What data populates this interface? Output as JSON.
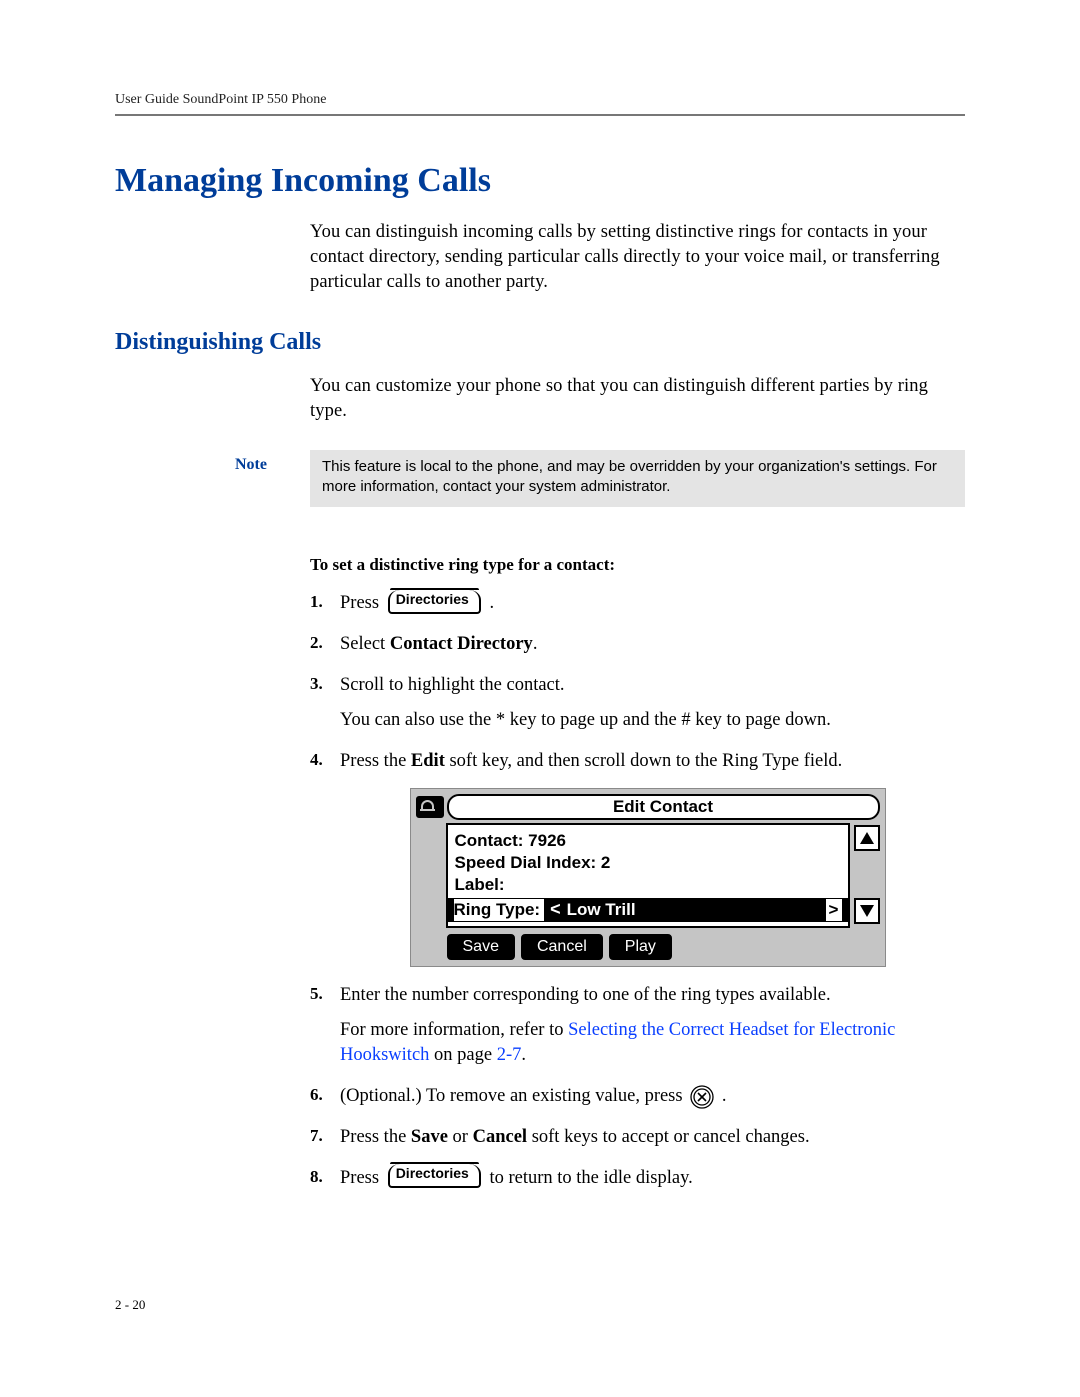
{
  "running_head": "User Guide SoundPoint IP 550 Phone",
  "h1": "Managing Incoming Calls",
  "intro_p": "You can distinguish incoming calls by setting distinctive rings for contacts in your contact directory, sending particular calls directly to your voice mail, or transferring particular calls to another party.",
  "h2": "Distinguishing Calls",
  "h2_p": "You can customize your phone so that you can distinguish different parties by ring type.",
  "note_label": "Note",
  "note_text": "This feature is local to the phone, and may be overridden by your organization's settings. For more information, contact your system administrator.",
  "proc_title": "To set a distinctive ring type for a contact:",
  "dir_key_label": "Directories",
  "steps": {
    "s1_a": "Press ",
    "s1_b": " .",
    "s2_a": "Select ",
    "s2_bold": "Contact Directory",
    "s2_b": ".",
    "s3": "Scroll to highlight the contact.",
    "s3_sub": "You can also use the * key to page up and the # key to page down.",
    "s4_a": "Press the ",
    "s4_bold": "Edit",
    "s4_b": " soft key, and then scroll down to the Ring Type field.",
    "s5": "Enter the number corresponding to one of the ring types available.",
    "s5_sub_a": "For more information, refer to ",
    "s5_link": "Selecting the Correct Headset for Electronic Hookswitch",
    "s5_sub_b": " on page ",
    "s5_link2": "2-7",
    "s5_sub_c": ".",
    "s6_a": "(Optional.) To remove an existing value, press ",
    "s6_b": " .",
    "s7_a": "Press the ",
    "s7_b1": "Save",
    "s7_mid": " or ",
    "s7_b2": "Cancel",
    "s7_c": " soft keys to accept or cancel changes.",
    "s8_a": "Press ",
    "s8_b": " to return to the idle display."
  },
  "lcd": {
    "title": "Edit Contact",
    "contact": "Contact: 7926",
    "speed": "Speed Dial Index: 2",
    "label": "Label:",
    "ring_prefix": "Ring Type: ",
    "ring_value": "Low Trill",
    "save": "Save",
    "cancel": "Cancel",
    "play": "Play"
  },
  "page_num": "2 - 20"
}
